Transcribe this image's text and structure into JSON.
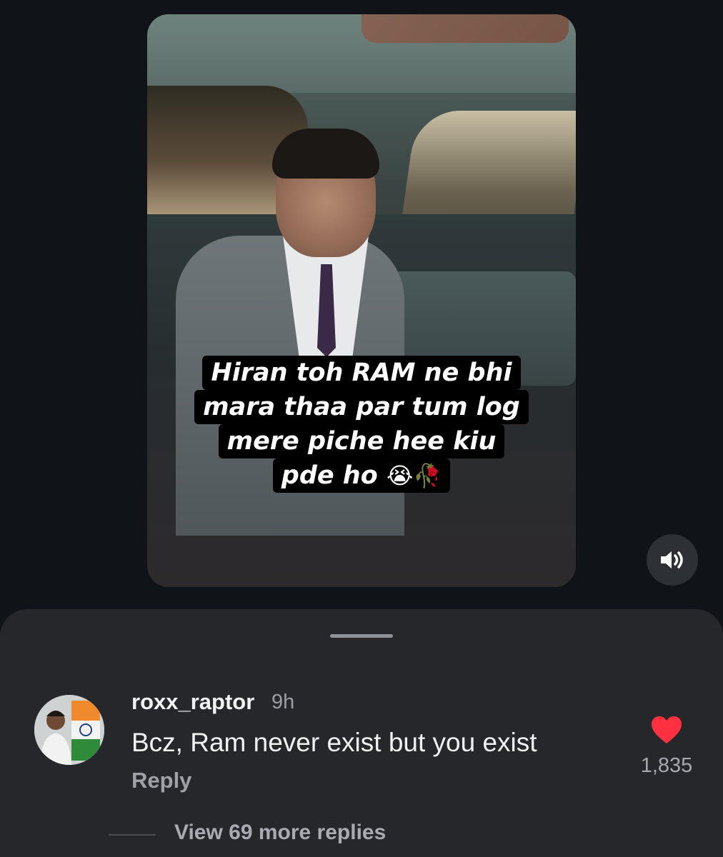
{
  "reel": {
    "caption_lines": [
      "Hiran toh RAM ne bhi",
      "mara thaa par tum log",
      "mere piche hee kiu",
      "pde ho"
    ],
    "caption_emojis": "😭🥀",
    "sound_icon": "speaker-on-icon"
  },
  "comments": {
    "items": [
      {
        "username": "roxx_raptor",
        "time": "9h",
        "text": "Bcz, Ram never exist but you exist",
        "reply_label": "Reply",
        "like_count": "1,835",
        "liked": true
      }
    ],
    "view_more_label": "View 69 more replies"
  },
  "colors": {
    "like": "#ff3040",
    "sheet_bg": "#25272b",
    "page_bg": "#101317"
  }
}
